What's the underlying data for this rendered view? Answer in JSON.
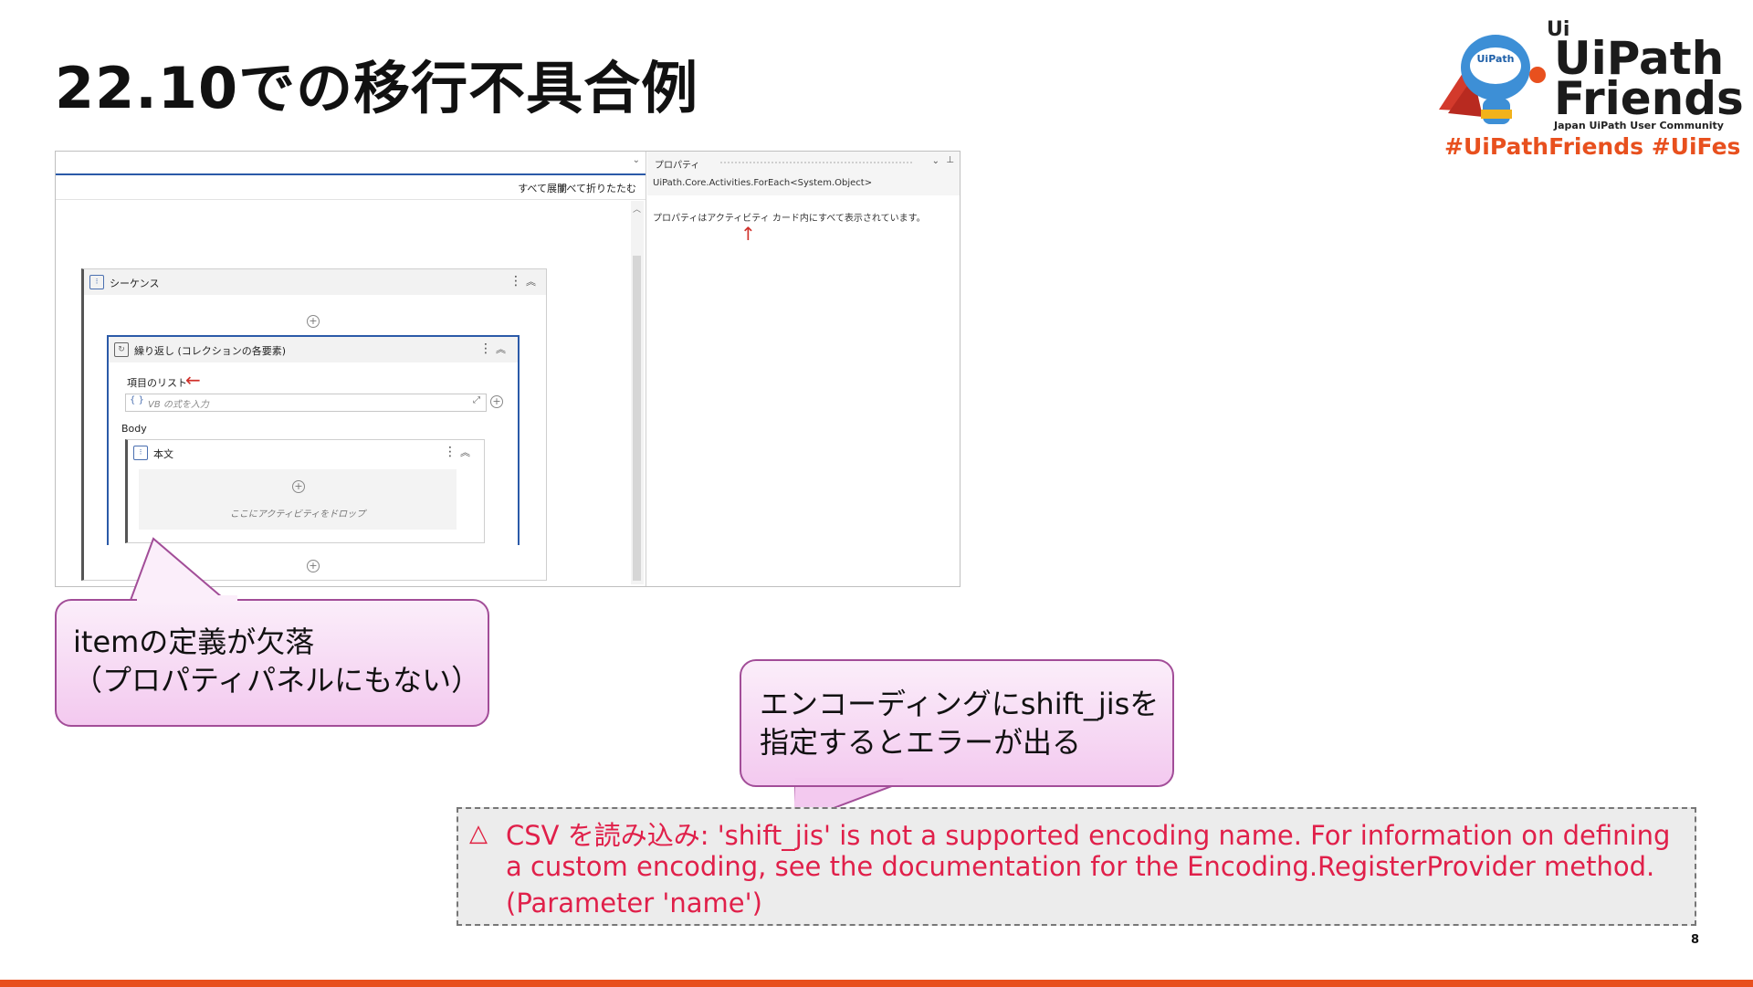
{
  "slide": {
    "title": "22.10での移行不具合例",
    "page_number": "8"
  },
  "logo": {
    "ui_mark": "Ui",
    "mascot_badge": "UiPath",
    "line1": "UiPath",
    "line2": "Friends",
    "subtitle": "Japan UiPath User Community",
    "hashtags": "#UiPathFriends  #UiFes"
  },
  "designer": {
    "toolbar": {
      "expand_all": "すべて展開",
      "collapse_all": "すべて折りたたむ"
    },
    "sequence": {
      "title": "シーケンス"
    },
    "foreach": {
      "title": "繰り返し (コレクションの各要素)",
      "items_label": "項目のリスト",
      "vb_placeholder": "VB の式を入力",
      "body_label": "Body"
    },
    "body": {
      "title": "本文",
      "drop_text": "ここにアクティビティをドロップ"
    },
    "properties": {
      "title": "プロパティ",
      "type_name": "UiPath.Core.Activities.ForEach<System.Object>",
      "message": "プロパティはアクティビティ カード内にすべて表示されています。"
    }
  },
  "callouts": {
    "missing_item": {
      "line1": "itemの定義が欠落",
      "line2": "（プロパティパネルにもない）"
    },
    "encoding": {
      "line1": "エンコーディングにshift_jisを",
      "line2": "指定するとエラーが出る"
    }
  },
  "error": {
    "line1": "CSV を読み込み: 'shift_jis' is not a supported encoding name. For information on defining",
    "line2": "a custom encoding, see the documentation for the Encoding.RegisterProvider method.",
    "line3": "(Parameter 'name')"
  },
  "colors": {
    "accent": "#e8501e",
    "callout_border": "#a24d98",
    "error_text": "#e0204a",
    "annotation_arrow": "#d0302a"
  }
}
